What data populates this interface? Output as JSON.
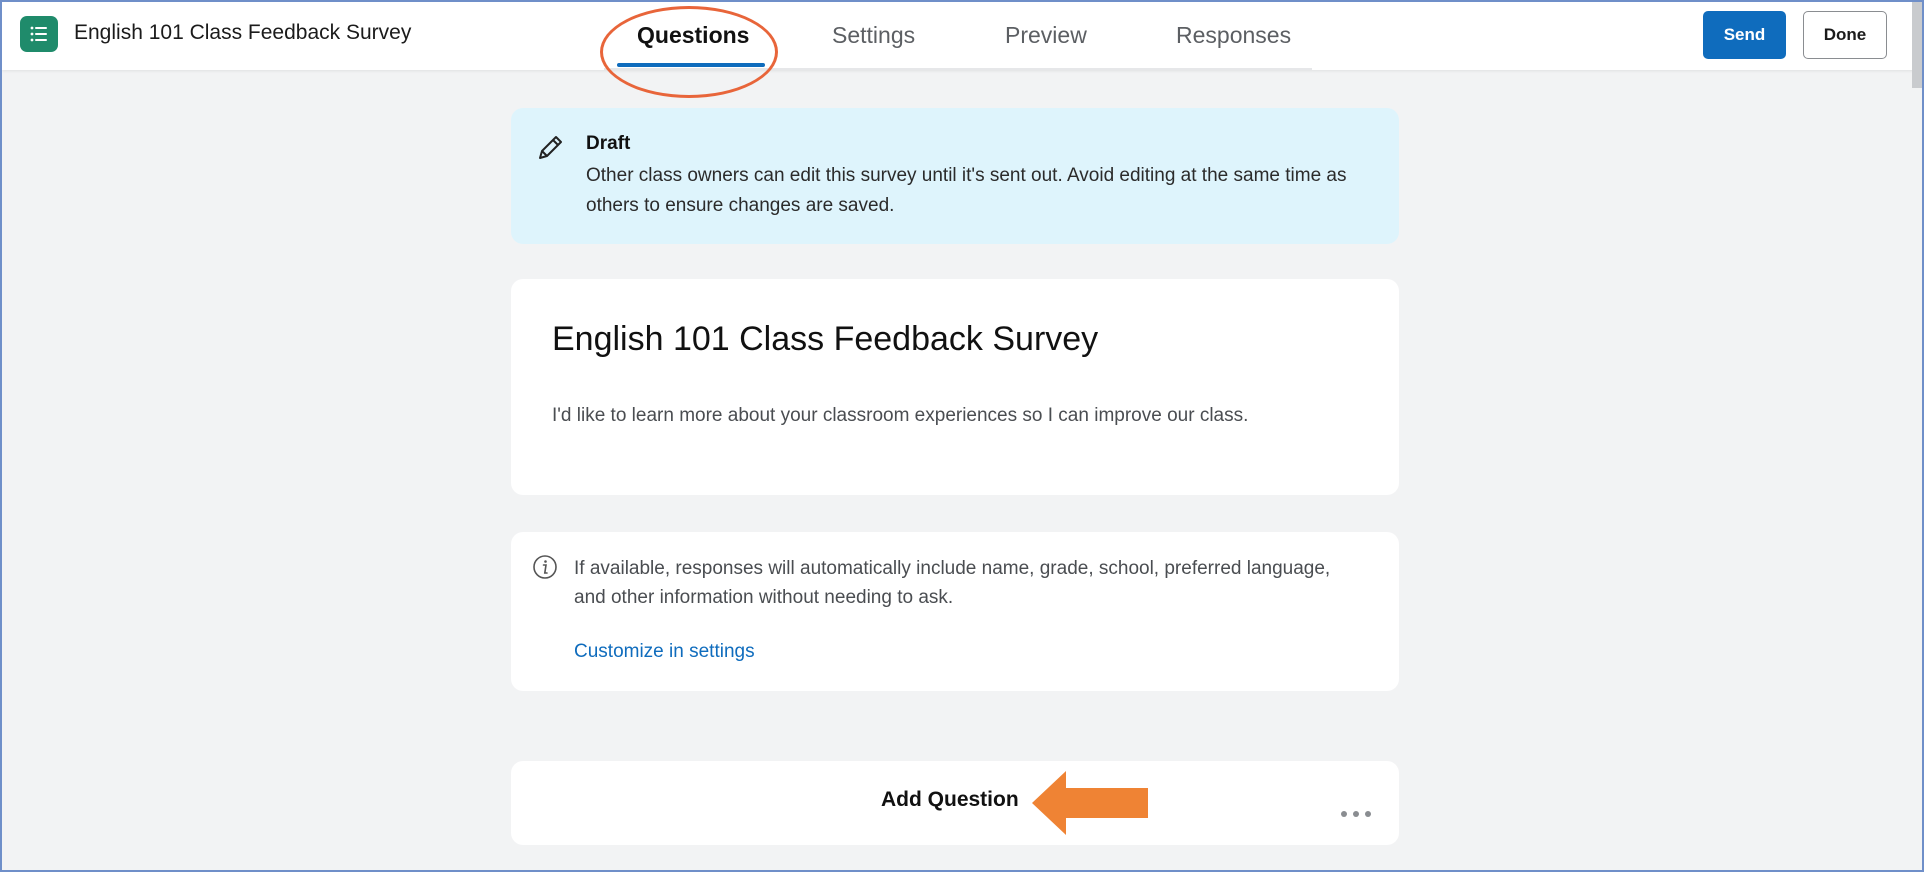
{
  "app": {
    "survey_name": "English 101 Class Feedback Survey",
    "icon": "list-icon"
  },
  "tabs": [
    {
      "label": "Questions",
      "active": true
    },
    {
      "label": "Settings",
      "active": false
    },
    {
      "label": "Preview",
      "active": false
    },
    {
      "label": "Responses",
      "active": false
    }
  ],
  "actions": {
    "send_label": "Send",
    "done_label": "Done"
  },
  "draft_notice": {
    "icon": "pencil-icon",
    "title": "Draft",
    "text": "Other class owners can edit this survey until it's sent out. Avoid editing at the same time as others to ensure changes are saved."
  },
  "form": {
    "title": "English 101 Class Feedback Survey",
    "description": "I'd like to learn more about your classroom experiences so I can improve our class."
  },
  "info_notice": {
    "icon": "info-icon",
    "text": "If available, responses will automatically include name, grade, school, preferred language, and other information without needing to ask.",
    "link": "Customize in settings"
  },
  "add_question": {
    "label": "Add Question",
    "more_icon": "more-horizontal-icon"
  },
  "colors": {
    "accent": "#0f6cbd",
    "app_icon": "#1f8b6b",
    "draft_bg": "#def4fc",
    "annotation": "#e8653a",
    "arrow": "#ef8334",
    "page_bg": "#f2f3f4"
  }
}
